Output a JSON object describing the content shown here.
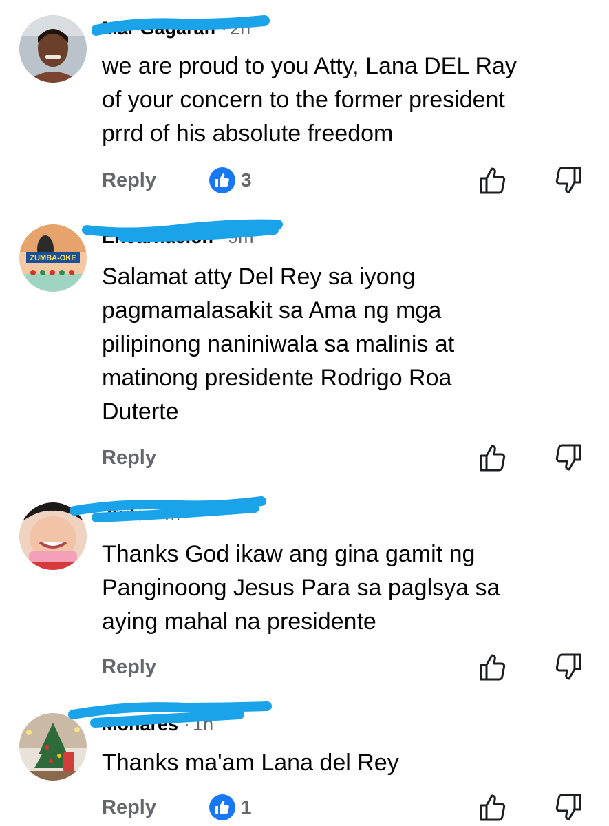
{
  "comments": [
    {
      "name": "Mar Gagaran",
      "time": "2h",
      "lines": [
        "we are proud to you Atty, Lana DEL Ray",
        "of your concern to the former president",
        "prrd  of his absolute freedom"
      ],
      "reply_label": "Reply",
      "reaction_count": "3"
    },
    {
      "name": "Encarnacion",
      "time": "9m",
      "avatar_text": "ZUMBA-OKE",
      "lines": [
        "Salamat atty Del Rey sa iyong",
        "pagmamalasakit sa Ama ng mga",
        "pilipinong naniniwala sa malinis at",
        "matinong presidente Rodrigo Roa",
        "Duterte"
      ],
      "reply_label": "Reply"
    },
    {
      "name": "Judei",
      "time": "m",
      "lines": [
        "Thanks God ikaw ang gina gamit ng",
        "Panginoong Jesus Para sa paglsya sa",
        "aying mahal na presidente"
      ],
      "reply_label": "Reply"
    },
    {
      "name": "Monares",
      "time": "1h",
      "lines": [
        "Thanks ma'am Lana del Rey"
      ],
      "reply_label": "Reply",
      "reaction_count": "1"
    }
  ],
  "icons": {
    "reaction": "like-icon",
    "upvote": "thumbs-up-outline-icon",
    "downvote": "thumbs-down-outline-icon"
  },
  "colors": {
    "like_blue": "#1877f2",
    "secondary_text": "#65676b",
    "redaction_scribble": "#1aa3e8"
  }
}
